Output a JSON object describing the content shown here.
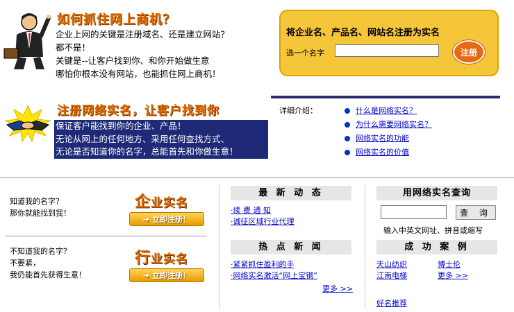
{
  "intro": {
    "title": "如何抓住网上商机？",
    "lines": [
      "企业上网的关键是注册域名、还是建立网站？",
      "都不是！",
      "关键是--让客户找到你、和你开始做生意",
      "哪怕你根本没有网站，也能抓住网上商机！"
    ]
  },
  "register": {
    "title": "将企业名、产品名、网站名注册为实名",
    "label": "选一个名字",
    "input_value": "",
    "button": "注册"
  },
  "netname": {
    "title": "注册网络实名，让客户找到你",
    "banner_lines": [
      "保证客户能找到你的企业、产品！",
      "无论从网上的任何地方、采用任何查找方式、",
      "无论是否知道你的名字，总能首先和你做生意！"
    ]
  },
  "details": {
    "label": "详细介绍：",
    "items": [
      "什么是网络实名？",
      "为什么需要网络实名？",
      "网络实名的功能",
      "网络实名的价值"
    ]
  },
  "enterprise": {
    "q_lines": [
      "知道我的名字？",
      "那你就能找到我！"
    ],
    "brand_first": "企",
    "brand_rest": "业实名",
    "register_now": "立即注册！"
  },
  "industry": {
    "q_lines": [
      "不知道我的名字？",
      "不要紧，",
      "我仍能首先获得生意！"
    ],
    "brand_first": "行",
    "brand_rest": "业实名",
    "register_now": "立即注册！"
  },
  "latest": {
    "title": "最 新 动 态",
    "items": [
      "·续 费 通 知",
      "·诚征区域行业代理"
    ]
  },
  "hot": {
    "title": "热 点 新 闻",
    "items": [
      "·紧紧抓住盈利的手",
      "·网络实名激活“网上宝钢”"
    ],
    "more": "更多 >>"
  },
  "query": {
    "title": "用网络实名查询",
    "input_value": "",
    "button": "查 询",
    "hint": "输入中英文网址、拼音或缩写"
  },
  "cases": {
    "title": "成 功 案 例",
    "items": [
      "天山纺织",
      "博士伦",
      "江南电梯",
      "更多 >>"
    ],
    "footer_link": "好名推荐"
  },
  "colors": {
    "accent_orange": "#e06a00",
    "banner_navy": "#1e2a78",
    "box_yellow": "#f5c53a",
    "link_blue": "#0000cc"
  },
  "icons": {
    "businessman": "businessman-pointing-icon",
    "handshake": "handshake-icon"
  }
}
